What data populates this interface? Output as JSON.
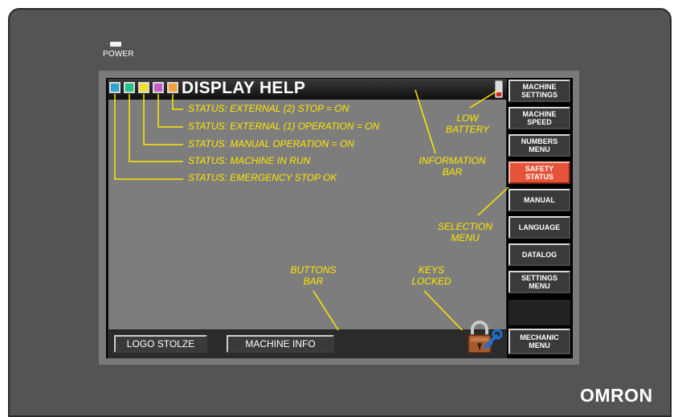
{
  "power_label": "POWER",
  "info_bar": {
    "title": "DISPLAY HELP",
    "status_squares": [
      {
        "color": "#2aa6d6",
        "icon": "status-square-1-icon"
      },
      {
        "color": "#23c28a",
        "icon": "status-square-2-icon"
      },
      {
        "color": "#f2df2b",
        "icon": "status-square-3-icon"
      },
      {
        "color": "#c35bc8",
        "icon": "status-square-4-icon"
      },
      {
        "color": "#f3a23a",
        "icon": "status-square-5-icon"
      }
    ],
    "battery_icon": "low-battery-icon"
  },
  "status_lines": [
    "STATUS: EXTERNAL (2) STOP = ON",
    "STATUS: EXTERNAL (1) OPERATION = ON",
    "STATUS: MANUAL OPERATION = ON",
    "STATUS: MACHINE IN RUN",
    "STATUS: EMERGENCY STOP OK"
  ],
  "annotations": {
    "low_battery": "LOW\nBATTERY",
    "information_bar": "INFORMATION\nBAR",
    "selection_menu": "SELECTION\nMENU",
    "buttons_bar": "BUTTONS\nBAR",
    "keys_locked": "KEYS\nLOCKED"
  },
  "side_menu": [
    {
      "label": "MACHINE\nSETTINGS",
      "active": false
    },
    {
      "label": "MACHINE\nSPEED",
      "active": false
    },
    {
      "label": "NUMBERS\nMENU",
      "active": false
    },
    {
      "label": "SAFETY\nSTATUS",
      "active": true
    },
    {
      "label": "MANUAL",
      "active": false
    },
    {
      "label": "LANGUAGE",
      "active": false
    },
    {
      "label": "DATALOG",
      "active": false
    },
    {
      "label": "SETTINGS\nMENU",
      "active": false
    },
    {
      "label": "MECHANIC\nMENU",
      "active": false
    }
  ],
  "bottom_buttons": {
    "logo": "LOGO STOLZE",
    "machine_info": "MACHINE INFO"
  },
  "keys_lock_icon": "padlock-key-icon",
  "brand": "OMRON",
  "colors": {
    "annotation": "#ffe800",
    "active_button": "#e5533a",
    "screen_gray": "#7d7d7d"
  }
}
